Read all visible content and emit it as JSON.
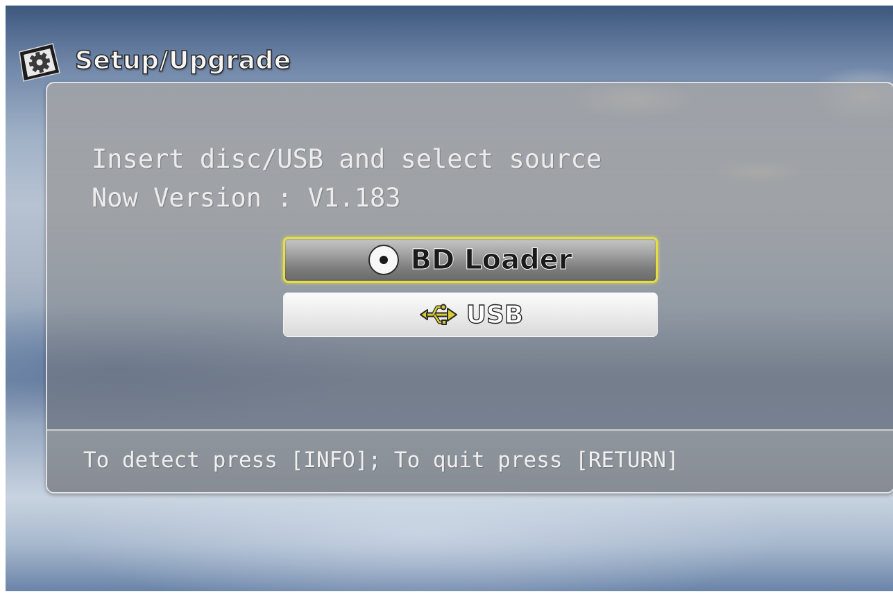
{
  "header": {
    "title": "Setup/Upgrade",
    "icon": "gear-icon"
  },
  "panel": {
    "instruction": "Insert disc/USB and select source",
    "version_line": "Now Version : V1.183"
  },
  "options": [
    {
      "label": "BD Loader",
      "icon": "disc-icon",
      "selected": true
    },
    {
      "label": "USB",
      "icon": "usb-icon",
      "selected": false
    }
  ],
  "footer": {
    "hint": "To detect press [INFO]; To quit press [RETURN]"
  },
  "colors": {
    "selection_outline": "#e6df42",
    "usb_icon": "#d9cf34",
    "text": "#ececec"
  }
}
